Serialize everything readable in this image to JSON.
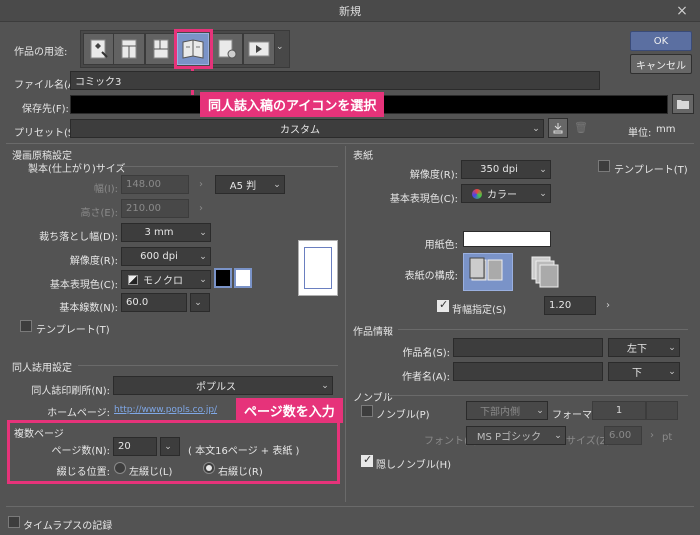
{
  "window": {
    "title": "新規"
  },
  "usage": {
    "label": "作品の用途:",
    "icons": [
      "illustration-icon",
      "webtoon-icon",
      "comic-icon",
      "doujin-icon",
      "comic-settings-icon",
      "animation-icon"
    ]
  },
  "file_name": {
    "label": "ファイル名(A):",
    "value": "コミック3"
  },
  "save_to": {
    "label": "保存先(F):"
  },
  "preset": {
    "label": "プリセット(S):",
    "value": "カスタム"
  },
  "unit": {
    "label": "単位:",
    "value": "mm"
  },
  "buttons": {
    "ok": "OK",
    "cancel": "キャンセル"
  },
  "callouts": {
    "top": "同人誌入稿のアイコンを選択",
    "pages": "ページ数を入力"
  },
  "manga": {
    "header": "漫画原稿設定",
    "size_header": "製本(仕上がり)サイズ",
    "width": {
      "label": "幅(I):",
      "value": "148.00",
      "preset": "A5 判"
    },
    "height": {
      "label": "高さ(E):",
      "value": "210.00"
    },
    "bleed": {
      "label": "裁ち落とし幅(D):",
      "value": "3 mm"
    },
    "resolution": {
      "label": "解像度(R):",
      "value": "600 dpi"
    },
    "color": {
      "label": "基本表現色(C):",
      "value": "モノクロ"
    },
    "lines": {
      "label": "基本線数(N):",
      "value": "60.0"
    },
    "template": "テンプレート(T)"
  },
  "doujin": {
    "header": "同人誌用設定",
    "printer": {
      "label": "同人誌印刷所(N):",
      "value": "ポプルス"
    },
    "homepage": {
      "label": "ホームページ:",
      "url": "http://www.popls.co.jp/"
    }
  },
  "multi": {
    "header": "複数ページ",
    "pages": {
      "label": "ページ数(N):",
      "value": "20",
      "note": "( 本文16ページ + 表紙 )"
    },
    "binding": {
      "label": "綴じる位置:",
      "left": "左綴じ(L)",
      "right": "右綴じ(R)"
    }
  },
  "cover": {
    "header": "表紙",
    "resolution": {
      "label": "解像度(R):",
      "value": "350 dpi"
    },
    "color": {
      "label": "基本表現色(C):",
      "value": "カラー"
    },
    "template": "テンプレート(T)",
    "paper": {
      "label": "用紙色:"
    },
    "structure": {
      "label": "表紙の構成:"
    },
    "spine": {
      "label": "背幅指定(S)",
      "value": "1.20"
    }
  },
  "work_info": {
    "header": "作品情報",
    "title": {
      "label": "作品名(S):",
      "pos": "左下"
    },
    "author": {
      "label": "作者名(A):",
      "pos": "下"
    }
  },
  "nombre": {
    "header": "ノンブル",
    "enable": "ノンブル(P)",
    "position": "下部内側",
    "format_label": "フォーマット:",
    "format_value": "1",
    "font_label": "フォント(F):",
    "font_value": "MS Pゴシック",
    "size_label": "サイズ(Z):",
    "size_value": "6.00",
    "size_unit": "pt",
    "hidden": "隠しノンブル(H)"
  },
  "timelapse": "タイムラプスの記録"
}
